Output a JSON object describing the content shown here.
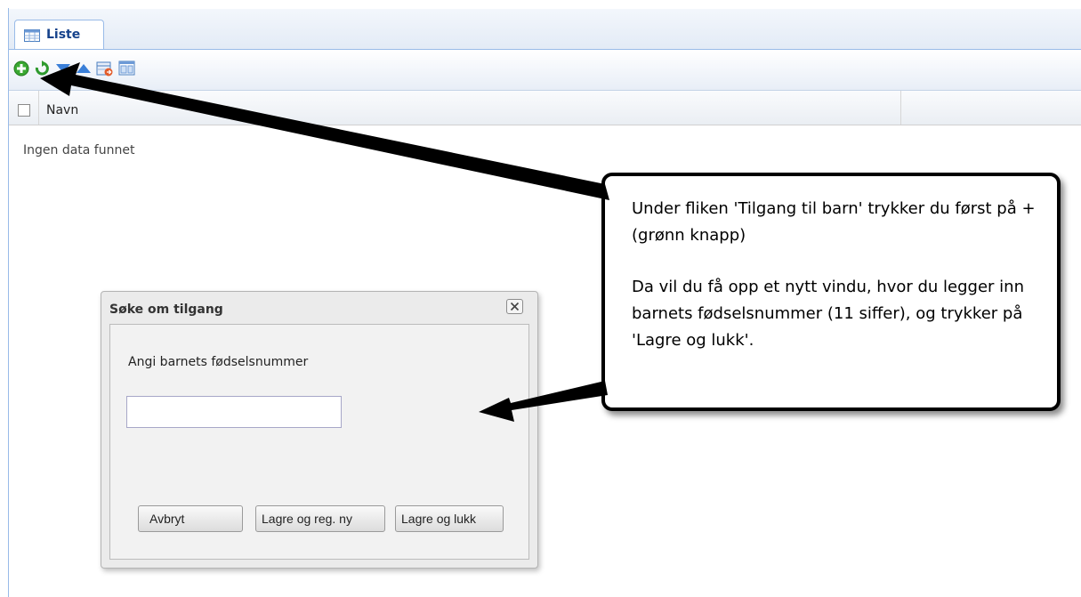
{
  "tab": {
    "label": "Liste"
  },
  "toolbar": {
    "icons": [
      "add-icon",
      "refresh-icon",
      "sort-down-icon",
      "sort-up-icon",
      "export-icon",
      "columns-icon"
    ]
  },
  "grid": {
    "column_name": "Navn",
    "empty_text": "Ingen data funnet"
  },
  "dialog": {
    "title": "Søke om tilgang",
    "prompt": "Angi barnets fødselsnummer",
    "ssn_value": "",
    "cancel_label": "Avbryt",
    "save_new_label": "Lagre og reg. ny",
    "save_close_label": "Lagre og lukk"
  },
  "callout": {
    "text1": "Under fliken 'Tilgang til barn' trykker du først på + (grønn knapp)",
    "text2": "Da vil du få opp et nytt vindu, hvor du legger inn barnets fødselsnummer (11 siffer), og trykker på 'Lagre og lukk'."
  },
  "colors": {
    "add_green": "#3aa832",
    "sort_blue": "#3a7fd8",
    "border_blue": "#99bbe8"
  }
}
